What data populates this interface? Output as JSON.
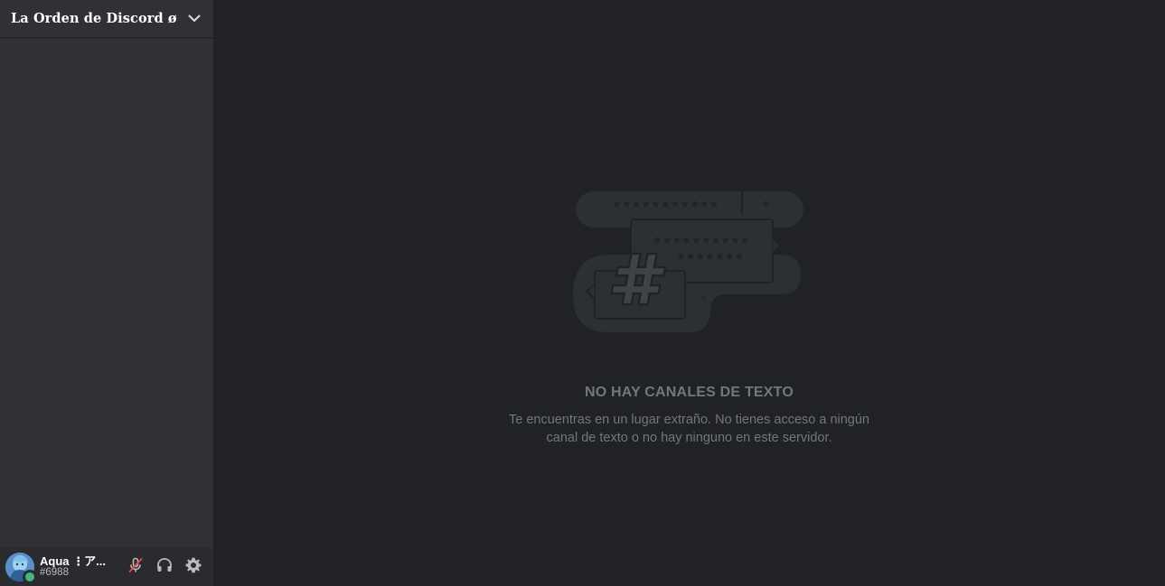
{
  "server": {
    "name": "La Orden de Discord ø"
  },
  "user": {
    "name": "Aqua ⋮ア...",
    "discriminator": "#6988",
    "status": "online"
  },
  "empty_state": {
    "title": "NO HAY CANALES DE TEXTO",
    "description_line1": "Te encuentras en un lugar extraño. No tienes acceso a ningún",
    "description_line2": "canal de texto o no hay ninguno en este servidor.",
    "illustration_icon": "hash-chat-bubbles-icon"
  },
  "colors": {
    "sidebar_bg": "#2f3136",
    "main_bg": "#202225",
    "user_panel_bg": "#292b2f",
    "status_online": "#43b581",
    "muted_red": "#f04747"
  }
}
